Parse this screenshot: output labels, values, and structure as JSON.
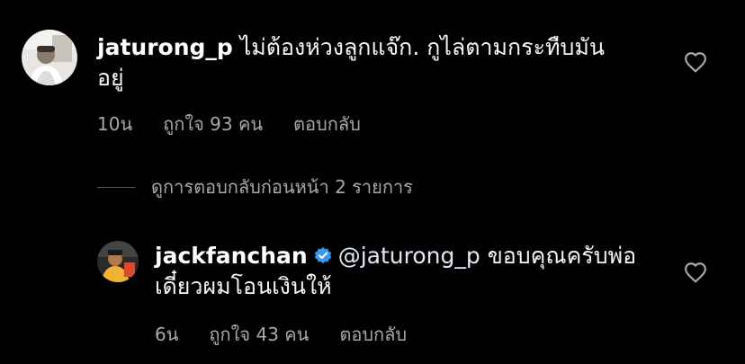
{
  "colors": {
    "background": "#000000",
    "text": "#f5f5f5",
    "meta": "#a8a8a8",
    "verified_badge": "#3897f0"
  },
  "comments": [
    {
      "avatar_icon": "user-avatar-photo",
      "username": "jaturong_p",
      "text_line1": "ไม่ต้องห่วงลูกแจ๊ก. กูไล่ตามกระทืบมัน",
      "text_line2": "อยู่",
      "time": "10น",
      "likes": "ถูกใจ 93 คน",
      "reply_label": "ตอบกลับ",
      "like_icon": "heart-outline-icon"
    }
  ],
  "view_replies": {
    "label": "ดูการตอบกลับก่อนหน้า 2 รายการ"
  },
  "replies": [
    {
      "avatar_icon": "user-avatar-photo",
      "username": "jackfanchan",
      "verified": true,
      "mention": "@jaturong_p",
      "text_after_mention": " ขอบคุณครับพ่อ",
      "text_line2": "เดี๋ยวผมโอนเงินให้",
      "time": "6น",
      "likes": "ถูกใจ 43 คน",
      "reply_label": "ตอบกลับ",
      "like_icon": "heart-outline-icon"
    }
  ]
}
